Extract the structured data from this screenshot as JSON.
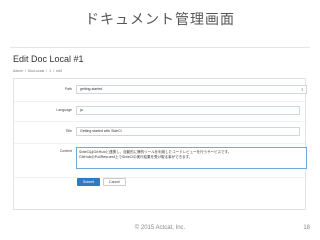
{
  "slide": {
    "title": "ドキュメント管理画面",
    "footer": "© 2015 Actcat, Inc.",
    "page_number": "18"
  },
  "page": {
    "title": "Edit Doc Local #1",
    "breadcrumb": [
      "Admin",
      "/",
      "DocLocals",
      "/",
      "1",
      "/",
      "edit"
    ]
  },
  "form": {
    "path": {
      "label": "Path",
      "value": "getting-started"
    },
    "language": {
      "label": "Language",
      "value": "ja"
    },
    "title": {
      "label": "Title",
      "value": "Getting started with SideCI"
    },
    "content": {
      "label": "Content",
      "value": "SideCIはGitHubと連携し、自動的に静的ツールを利用したコードレビューを行うサービスです。\nGitHubのPullRequest上でSideCIの実行結果を受け取る事ができます。"
    },
    "submit_label": "Submit",
    "cancel_label": "Cancel"
  }
}
